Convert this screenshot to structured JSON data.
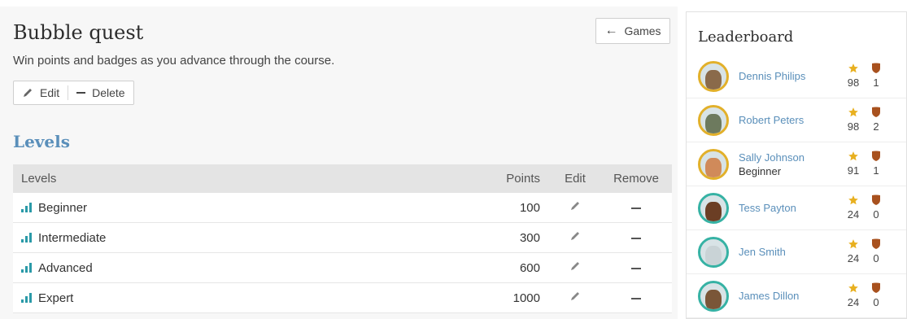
{
  "header": {
    "title": "Bubble quest",
    "subtitle": "Win points and badges as you advance through the course.",
    "games_button": "Games",
    "edit_label": "Edit",
    "delete_label": "Delete"
  },
  "levels": {
    "heading": "Levels",
    "columns": [
      "Levels",
      "Points",
      "Edit",
      "Remove"
    ],
    "rows": [
      {
        "name": "Beginner",
        "points": "100"
      },
      {
        "name": "Intermediate",
        "points": "300"
      },
      {
        "name": "Advanced",
        "points": "600"
      },
      {
        "name": "Expert",
        "points": "1000"
      }
    ]
  },
  "leaderboard": {
    "title": "Leaderboard",
    "entries": [
      {
        "name": "Dennis Philips",
        "level": "",
        "points": "98",
        "badges": "1",
        "avatar_ring": "#e2b02a",
        "skin": "#8a6a4a"
      },
      {
        "name": "Robert Peters",
        "level": "",
        "points": "98",
        "badges": "2",
        "avatar_ring": "#e2b02a",
        "skin": "#6d7a5e"
      },
      {
        "name": "Sally Johnson",
        "level": "Beginner",
        "points": "91",
        "badges": "1",
        "avatar_ring": "#e2b02a",
        "skin": "#d08a5a"
      },
      {
        "name": "Tess Payton",
        "level": "",
        "points": "24",
        "badges": "0",
        "avatar_ring": "#36b2a4",
        "skin": "#6b3e24"
      },
      {
        "name": "Jen Smith",
        "level": "",
        "points": "24",
        "badges": "0",
        "avatar_ring": "#36b2a4",
        "skin": "#c9d3d6"
      },
      {
        "name": "James Dillon",
        "level": "",
        "points": "24",
        "badges": "0",
        "avatar_ring": "#36b2a4",
        "skin": "#7a5638"
      }
    ]
  },
  "colors": {
    "accent_blue": "#5a8fba",
    "teal": "#2b9aa8",
    "star": "#e8b020",
    "badge": "#a8511e"
  }
}
